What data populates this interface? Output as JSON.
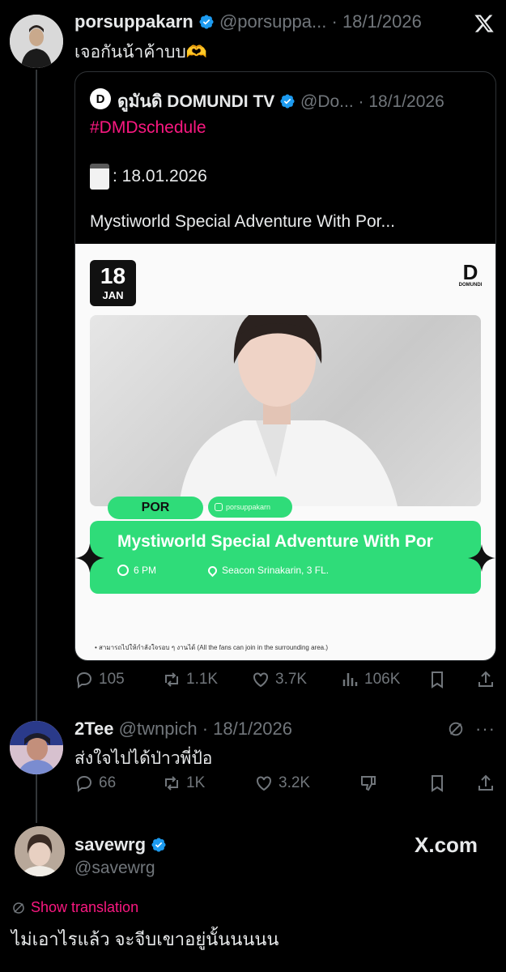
{
  "tweet1": {
    "display_name": "porsuppakarn",
    "handle": "@porsuppa...",
    "date": "· 18/1/2026",
    "text": "เจอกันน้าค้าบบ🫶",
    "actions": {
      "replies": "105",
      "reposts": "1.1K",
      "likes": "3.7K",
      "views": "106K"
    }
  },
  "quote": {
    "display_name": "ดูมันดิ DOMUNDI TV",
    "handle": "@Do...",
    "date": "· 18/1/2026",
    "hashtag": "#DMDschedule",
    "date_line": ": 18.01.2026",
    "title_line": "Mystiworld Special Adventure With Por...",
    "card": {
      "day": "18",
      "month": "JAN",
      "brand": "DOMUNDI",
      "name_tag": "POR",
      "ig_handle": "porsuppakarn",
      "event_title": "Mystiworld Special Adventure With Por",
      "time": "6 PM",
      "venue": "Seacon Srinakarin, 3 FL.",
      "footnote": "• สามารถไปให้กำลังใจรอบ ๆ งานได้  (All the fans can join in the surrounding area.)"
    }
  },
  "tweet2": {
    "display_name": "2Tee",
    "handle": "@twnpich",
    "date": "· 18/1/2026",
    "text": "ส่งใจไปได้ป่าวพี่ป้อ",
    "actions": {
      "replies": "66",
      "reposts": "1K",
      "likes": "3.2K"
    }
  },
  "tweet3": {
    "display_name": "savewrg",
    "handle": "@savewrg",
    "watermark": "X.com",
    "translate": "Show translation",
    "text": "ไม่เอาไรแล้ว จะจีบเขาอยู่นั้นนนนน"
  },
  "colors": {
    "accent_pink": "#f91880",
    "verified_blue": "#1d9bf0",
    "card_green": "#2fdc79"
  }
}
